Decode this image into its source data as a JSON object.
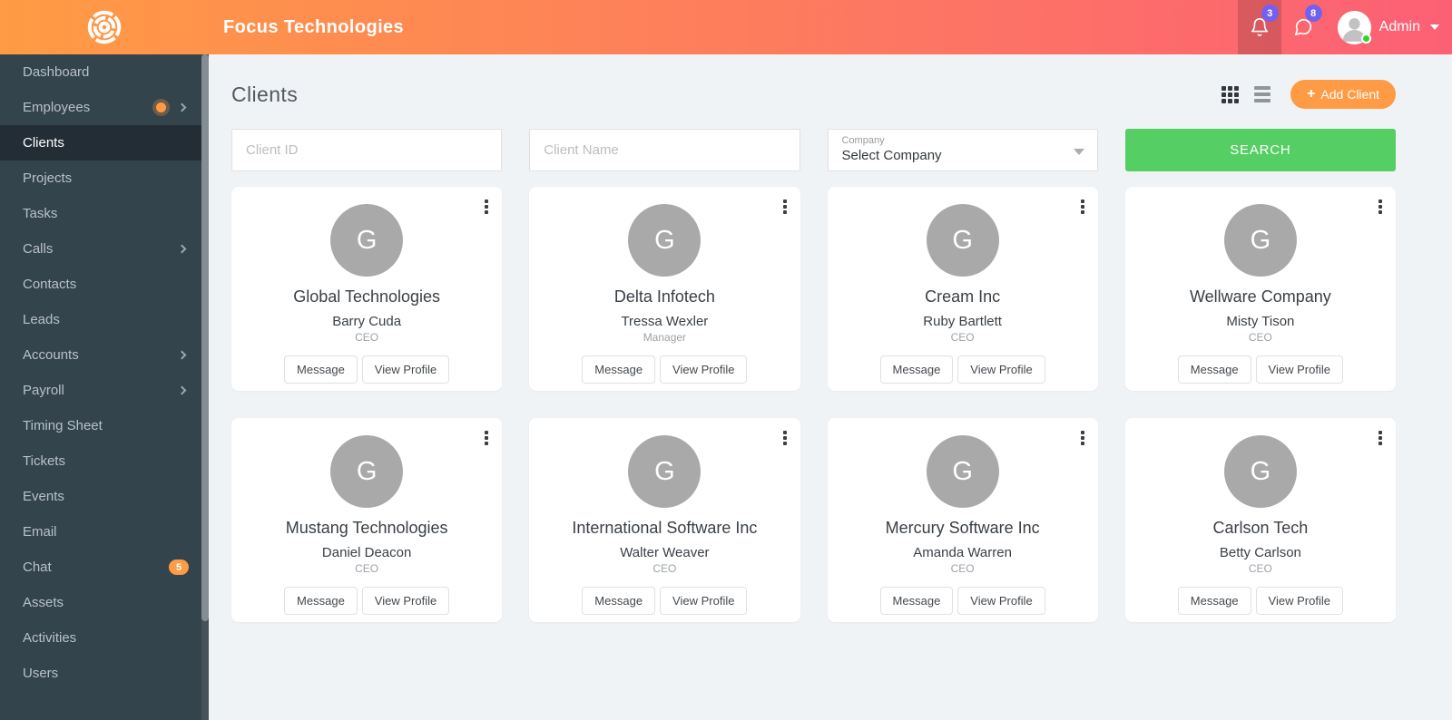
{
  "colors": {
    "header_gradient_start": "#FF9B44",
    "header_gradient_end": "#FC6075",
    "sidebar_bg": "#34444C",
    "sidebar_active_bg": "#232D36",
    "sidebar_text": "#B7C0CD",
    "accent_orange": "#FF9B44",
    "badge_purple": "#7460EE",
    "search_green": "#55CE63",
    "main_bg": "#F0F3F6",
    "avatar_gray": "#A9A9A9",
    "online_green": "#2BD62E"
  },
  "header": {
    "app_title": "Focus Technologies",
    "notification_count": "3",
    "message_count": "8",
    "user_name": "Admin"
  },
  "sidebar": {
    "items": [
      {
        "label": "Dashboard"
      },
      {
        "label": "Employees",
        "has_submenu": true,
        "has_notification_dot": true
      },
      {
        "label": "Clients",
        "active": true
      },
      {
        "label": "Projects"
      },
      {
        "label": "Tasks"
      },
      {
        "label": "Calls",
        "has_submenu": true
      },
      {
        "label": "Contacts"
      },
      {
        "label": "Leads"
      },
      {
        "label": "Accounts",
        "has_submenu": true
      },
      {
        "label": "Payroll",
        "has_submenu": true
      },
      {
        "label": "Timing Sheet"
      },
      {
        "label": "Tickets"
      },
      {
        "label": "Events"
      },
      {
        "label": "Email"
      },
      {
        "label": "Chat",
        "badge": "5"
      },
      {
        "label": "Assets"
      },
      {
        "label": "Activities"
      },
      {
        "label": "Users"
      }
    ]
  },
  "page": {
    "title": "Clients",
    "add_client_label": "Add Client",
    "plus_icon": "+"
  },
  "filters": {
    "client_id_placeholder": "Client ID",
    "client_name_placeholder": "Client Name",
    "company_label": "Company",
    "company_value": "Select Company",
    "search_label": "SEARCH"
  },
  "card_actions": {
    "message_label": "Message",
    "view_profile_label": "View Profile"
  },
  "cards": [
    {
      "initial": "G",
      "company": "Global Technologies",
      "contact": "Barry Cuda",
      "role": "CEO"
    },
    {
      "initial": "G",
      "company": "Delta Infotech",
      "contact": "Tressa Wexler",
      "role": "Manager"
    },
    {
      "initial": "G",
      "company": "Cream Inc",
      "contact": "Ruby Bartlett",
      "role": "CEO"
    },
    {
      "initial": "G",
      "company": "Wellware Company",
      "contact": "Misty Tison",
      "role": "CEO"
    },
    {
      "initial": "G",
      "company": "Mustang Technologies",
      "contact": "Daniel Deacon",
      "role": "CEO"
    },
    {
      "initial": "G",
      "company": "International Software Inc",
      "contact": "Walter Weaver",
      "role": "CEO"
    },
    {
      "initial": "G",
      "company": "Mercury Software Inc",
      "contact": "Amanda Warren",
      "role": "CEO"
    },
    {
      "initial": "G",
      "company": "Carlson Tech",
      "contact": "Betty Carlson",
      "role": "CEO"
    }
  ]
}
